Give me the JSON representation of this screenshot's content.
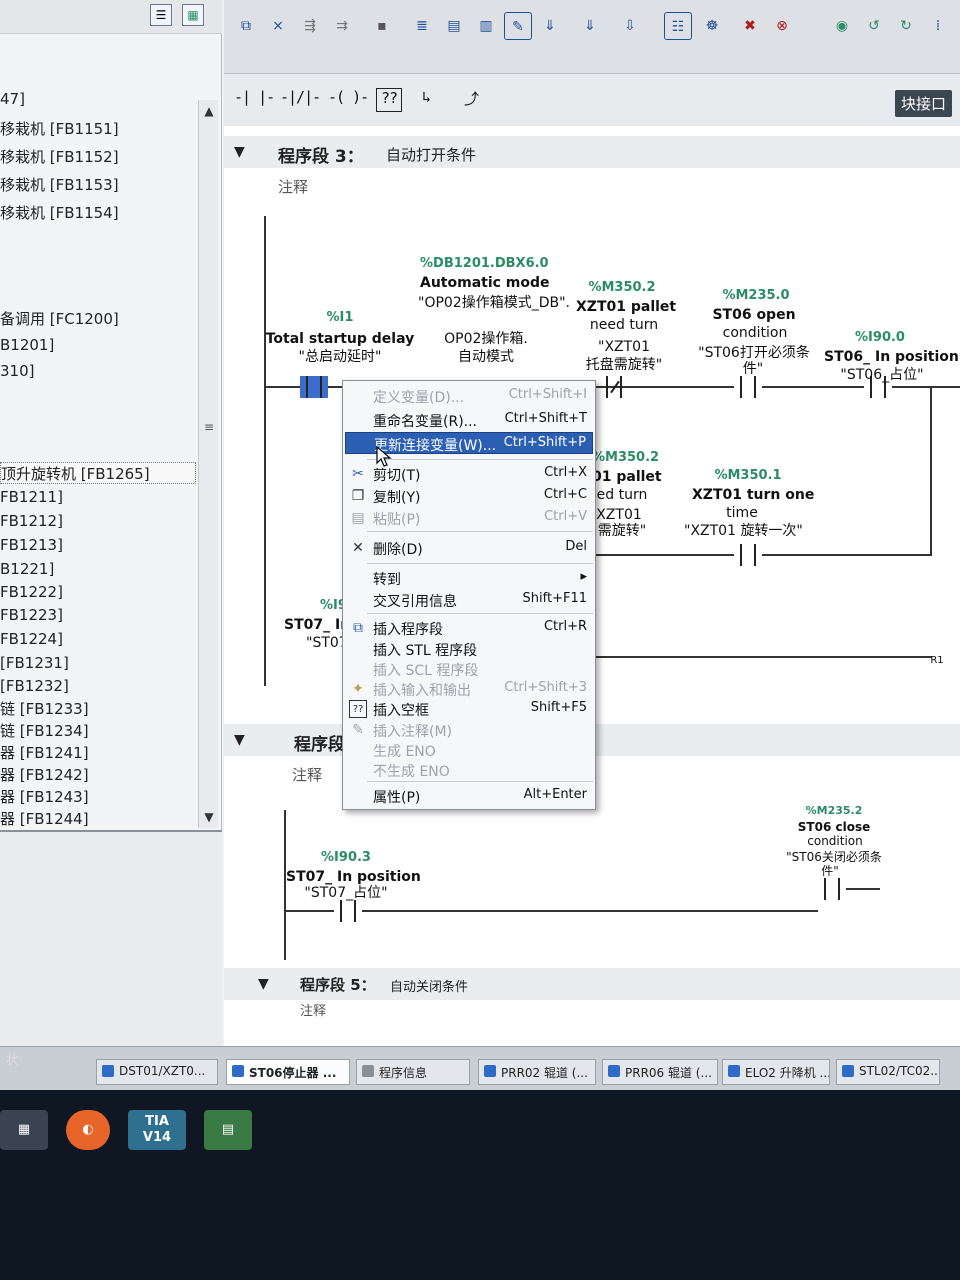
{
  "tree": {
    "items": [
      "47]",
      "移栽机 [FB1151]",
      "移栽机 [FB1152]",
      "移栽机 [FB1153]",
      "移栽机 [FB1154]",
      "备调用 [FC1200]",
      "B1201]",
      "310]",
      "顶升旋转机 [FB1265]",
      "FB1211]",
      "FB1212]",
      "FB1213]",
      "B1221]",
      "FB1222]",
      "FB1223]",
      "FB1224]",
      "[FB1231]",
      "[FB1232]",
      "链 [FB1233]",
      "链 [FB1234]",
      "器 [FB1241]",
      "器 [FB1242]",
      "器 [FB1243]",
      "器 [FB1244]"
    ]
  },
  "toolbar": {
    "block_interface_label": "块接口"
  },
  "networks": {
    "n3": {
      "title": "程序段 3：",
      "name": "自动打开条件",
      "comment": "注释"
    },
    "n4": {
      "title": "程序段",
      "comment": "注释"
    },
    "n5": {
      "title": "程序段 5：",
      "name": "自动关闭条件",
      "comment": "注释"
    }
  },
  "operands": {
    "c1": {
      "addr": "%I1",
      "line1": "Total startup delay",
      "line2": "\"总启动延时\""
    },
    "c2": {
      "addr": "%DB1201.DBX6.0",
      "line1": "Automatic mode",
      "line2": "\"OP02操作箱模式_DB\".",
      "line3": "OP02操作箱.",
      "line4": "自动模式"
    },
    "c3": {
      "addr": "%M350.2",
      "line1": "XZT01 pallet",
      "line2": "need turn",
      "line3": "\"XZT01",
      "line4": "托盘需旋转\""
    },
    "c4": {
      "addr": "%M235.0",
      "line1": "ST06 open",
      "line2": "condition",
      "line3": "\"ST06打开必须条",
      "line4": "件\""
    },
    "c5": {
      "addr": "%I90.0",
      "line1": "ST06_ In position",
      "line2": "\"ST06_占位\""
    },
    "c6": {
      "addr": "%M350.2",
      "line1": "01 pallet",
      "line2": "ed turn",
      "line3": "XZT01",
      "line4": "需旋转\""
    },
    "c7": {
      "addr": "%M350.1",
      "line1": "XZT01 turn one",
      "line2": "time",
      "line3": "\"XZT01 旋转一次\""
    },
    "c8": {
      "addr": "%I9",
      "line1": "ST07_ In",
      "line2": "\"ST07"
    },
    "rail_label": "R1",
    "c9": {
      "addr": "%I90.3",
      "line1": "ST07_ In position",
      "line2": "\"ST07_占位\""
    },
    "c10": {
      "addr": "%M235.2",
      "line1": "ST06 close",
      "line2": "condition",
      "line3": "\"ST06关闭必须条",
      "line4": "件\""
    }
  },
  "context_menu": {
    "define_var": {
      "label": "定义变量(D)...",
      "shortcut": "Ctrl+Shift+I"
    },
    "rename_var": {
      "label": "重命名变量(R)...",
      "shortcut": "Ctrl+Shift+T"
    },
    "rewire_var": {
      "label": "更新连接变量(W)...",
      "shortcut": "Ctrl+Shift+P"
    },
    "cut": {
      "label": "剪切(T)",
      "shortcut": "Ctrl+X"
    },
    "copy": {
      "label": "复制(Y)",
      "shortcut": "Ctrl+C"
    },
    "paste": {
      "label": "粘贴(P)",
      "shortcut": "Ctrl+V"
    },
    "delete": {
      "label": "删除(D)",
      "shortcut": "Del"
    },
    "goto": {
      "label": "转到",
      "shortcut": "▸"
    },
    "xref": {
      "label": "交叉引用信息",
      "shortcut": "Shift+F11"
    },
    "insert_network": {
      "label": "插入程序段",
      "shortcut": "Ctrl+R"
    },
    "insert_stl": {
      "label": "插入 STL 程序段",
      "shortcut": ""
    },
    "insert_scl": {
      "label": "插入 SCL 程序段",
      "shortcut": ""
    },
    "insert_io": {
      "label": "插入输入和输出",
      "shortcut": "Ctrl+Shift+3"
    },
    "insert_empty_box": {
      "label": "插入空框",
      "shortcut": "Shift+F5"
    },
    "insert_comment": {
      "label": "插入注释(M)",
      "shortcut": ""
    },
    "gen_eno": {
      "label": "生成 ENO",
      "shortcut": ""
    },
    "no_eno": {
      "label": "不生成 ENO",
      "shortcut": ""
    },
    "properties": {
      "label": "属性(P)",
      "shortcut": "Alt+Enter"
    }
  },
  "tabs": [
    "DST01/XZT0...",
    "ST06停止器 ...",
    "程序信息",
    "PRR02 辊道 (...",
    "PRR06 辊道 (...",
    "ELO2 升降机 ...",
    "STL02/TC02..."
  ],
  "status": {
    "left_text": "状"
  },
  "taskbar": {
    "tia_label": "TIA\nV14"
  }
}
